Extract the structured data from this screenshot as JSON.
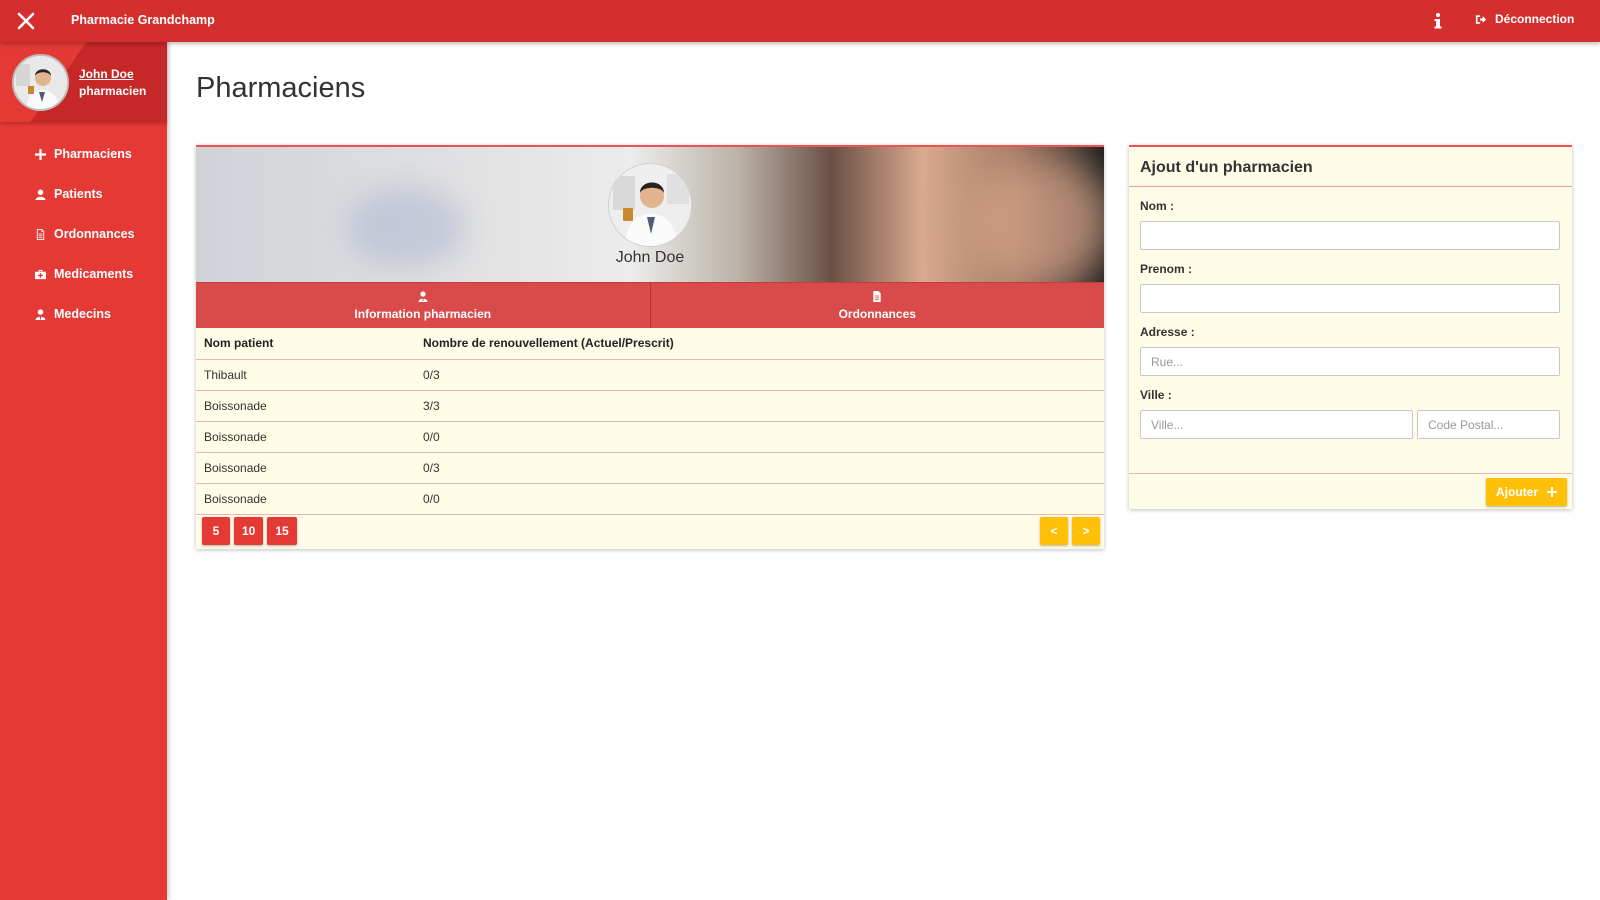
{
  "topbar": {
    "title": "Pharmacie Grandchamp",
    "logout_label": "Déconnection"
  },
  "user": {
    "name": "John Doe",
    "role": "pharmacien"
  },
  "sidebar": {
    "items": [
      {
        "label": "Pharmaciens",
        "icon": "plus-icon"
      },
      {
        "label": "Patients",
        "icon": "user-icon"
      },
      {
        "label": "Ordonnances",
        "icon": "document-icon"
      },
      {
        "label": "Medicaments",
        "icon": "medkit-icon"
      },
      {
        "label": "Medecins",
        "icon": "doctor-icon"
      }
    ]
  },
  "page": {
    "title": "Pharmaciens"
  },
  "profile": {
    "name": "John Doe",
    "tabs": [
      {
        "label": "Information pharmacien",
        "icon": "doctor-icon"
      },
      {
        "label": "Ordonnances",
        "icon": "document-icon"
      }
    ],
    "table": {
      "headers": [
        "Nom patient",
        "Nombre de renouvellement (Actuel/Prescrit)"
      ],
      "rows": [
        [
          "Thibault",
          "0/3"
        ],
        [
          "Boissonade",
          "3/3"
        ],
        [
          "Boissonade",
          "0/0"
        ],
        [
          "Boissonade",
          "0/3"
        ],
        [
          "Boissonade",
          "0/0"
        ]
      ]
    },
    "page_sizes": [
      "5",
      "10",
      "15"
    ],
    "prev_label": "<",
    "next_label": ">"
  },
  "form": {
    "title": "Ajout d'un pharmacien",
    "nom_label": "Nom :",
    "prenom_label": "Prenom :",
    "adresse_label": "Adresse :",
    "rue_placeholder": "Rue...",
    "ville_label": "Ville :",
    "ville_placeholder": "Ville...",
    "cp_placeholder": "Code Postal...",
    "submit_label": "Ajouter"
  },
  "colors": {
    "primary": "#d32f2f",
    "sidebar": "#e53935",
    "accent": "#ffc107",
    "card_bg": "#fffde7"
  }
}
